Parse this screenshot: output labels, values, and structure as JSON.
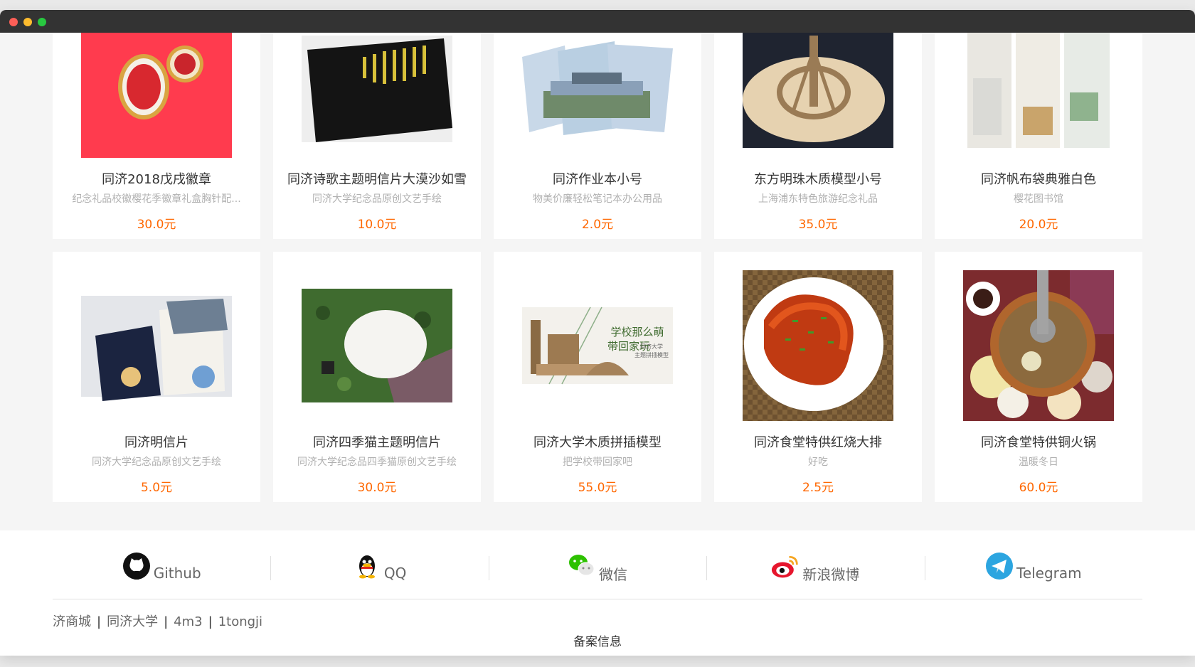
{
  "window": {
    "controls": [
      "close",
      "minimize",
      "maximize"
    ]
  },
  "products": [
    {
      "name": "同济2018戊戌徽章",
      "desc": "纪念礼品校徽樱花季徽章礼盒胸针配...",
      "price": "30.0元",
      "image": "badge-photo"
    },
    {
      "name": "同济诗歌主题明信片大漠沙如雪",
      "desc": "同济大学纪念品原创文艺手绘",
      "price": "10.0元",
      "image": "poetry-postcard-photo"
    },
    {
      "name": "同济作业本小号",
      "desc": "物美价廉轻松笔记本办公用品",
      "price": "2.0元",
      "image": "notebook-photo"
    },
    {
      "name": "东方明珠木质模型小号",
      "desc": "上海浦东特色旅游纪念礼品",
      "price": "35.0元",
      "image": "wooden-tower-photo"
    },
    {
      "name": "同济帆布袋典雅白色",
      "desc": "樱花图书馆",
      "price": "20.0元",
      "image": "canvas-bag-photo"
    },
    {
      "name": "同济明信片",
      "desc": "同济大学纪念品原创文艺手绘",
      "price": "5.0元",
      "image": "postcard-photo"
    },
    {
      "name": "同济四季猫主题明信片",
      "desc": "同济大学纪念品四季猫原创文艺手绘",
      "price": "30.0元",
      "image": "cat-postcard-photo"
    },
    {
      "name": "同济大学木质拼插模型",
      "desc": "把学校带回家吧",
      "price": "55.0元",
      "image": "wooden-model-photo",
      "image_text": [
        "学校那么萌",
        "带回家玩",
        "同济大学",
        "主题拼插模型"
      ]
    },
    {
      "name": "同济食堂特供红烧大排",
      "desc": "好吃",
      "price": "2.5元",
      "image": "pork-chop-photo"
    },
    {
      "name": "同济食堂特供铜火锅",
      "desc": "温暖冬日",
      "price": "60.0元",
      "image": "hotpot-photo"
    }
  ],
  "footer": {
    "socials": [
      {
        "label": "Github",
        "icon": "github-icon"
      },
      {
        "label": "QQ",
        "icon": "qq-icon"
      },
      {
        "label": "微信",
        "icon": "wechat-icon"
      },
      {
        "label": "新浪微博",
        "icon": "weibo-icon"
      },
      {
        "label": "Telegram",
        "icon": "telegram-icon"
      }
    ],
    "links": [
      "济商城",
      "同济大学",
      "4m3",
      "1tongji"
    ],
    "separator": "|",
    "beian": "备案信息"
  },
  "colors": {
    "price": "#ff6700",
    "titlebar": "#333333",
    "weibo": "#e6162d",
    "telegram": "#2ca5e0",
    "wechat": "#2dc100"
  }
}
